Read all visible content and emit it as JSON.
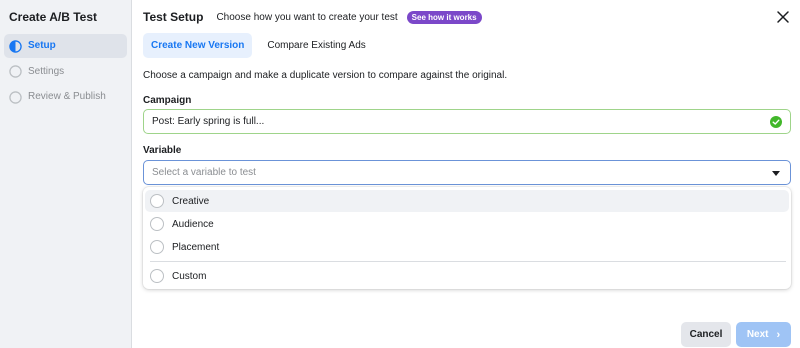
{
  "sidebar": {
    "title": "Create A/B Test",
    "steps": [
      {
        "label": "Setup",
        "active": true
      },
      {
        "label": "Settings",
        "active": false
      },
      {
        "label": "Review & Publish",
        "active": false
      }
    ]
  },
  "header": {
    "title": "Test Setup",
    "subtitle": "Choose how you want to create your test",
    "pill": "See how it works"
  },
  "tabs": [
    {
      "label": "Create New Version",
      "active": true
    },
    {
      "label": "Compare Existing Ads",
      "active": false
    }
  ],
  "description": "Choose a campaign and make a duplicate version to compare against the original.",
  "campaign": {
    "label": "Campaign",
    "value": "Post: Early spring is full..."
  },
  "variable": {
    "label": "Variable",
    "placeholder": "Select a variable to test",
    "options": [
      "Creative",
      "Audience",
      "Placement",
      "Custom"
    ]
  },
  "footer": {
    "cancel_label": "Cancel",
    "next_label": "Next"
  },
  "colors": {
    "accent": "#1877f2",
    "success": "#42b72a",
    "pill": "#7b48c9"
  }
}
